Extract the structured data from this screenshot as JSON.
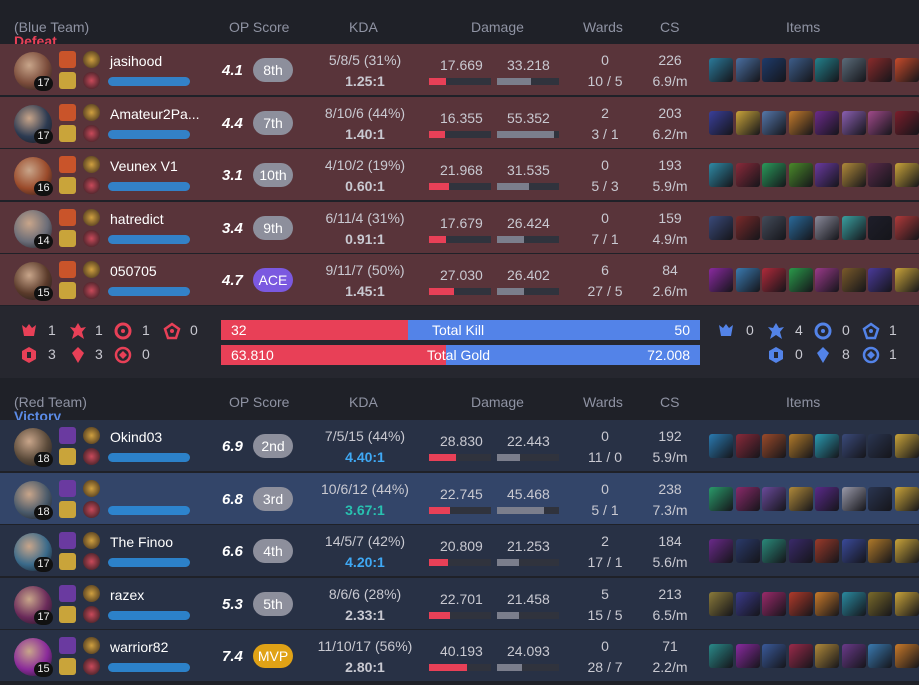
{
  "colors": {
    "defeat": "#e84057",
    "victory": "#5b8be6",
    "blue_team_bar": "#5383e8",
    "red_team_bar": "#e84057"
  },
  "columns": {
    "op_score": "OP Score",
    "kda": "KDA",
    "damage": "Damage",
    "wards": "Wards",
    "cs": "CS",
    "items": "Items"
  },
  "blue_team": {
    "result": "Defeat",
    "team_label": "(Blue Team)",
    "players": [
      {
        "name": "jasihood",
        "level": "17",
        "op": "4.1",
        "rank": "8th",
        "kda_line": "5/8/5 (31%)",
        "kda_ratio": "1.25:1",
        "dmg_dealt": "17.669",
        "dmg_taken": "33.218",
        "dmg_dealt_pct": 0.27,
        "dmg_taken_pct": 0.55,
        "wards_top": "0",
        "wards_bot": "10 / 5",
        "cs": "226",
        "cspm": "6.9/m",
        "champ_color": "#7a4b3a",
        "items": [
          "#2b7a9a",
          "#4a6fa1",
          "#1e3b6b",
          "#3d5d8a",
          "#23818c",
          "#5b6c7a",
          "#8a2b2b",
          "#c74b2b"
        ]
      },
      {
        "name": "Amateur2Pa...",
        "level": "17",
        "op": "4.4",
        "rank": "7th",
        "kda_line": "8/10/6 (44%)",
        "kda_ratio": "1.40:1",
        "dmg_dealt": "16.355",
        "dmg_taken": "55.352",
        "dmg_dealt_pct": 0.25,
        "dmg_taken_pct": 0.92,
        "wards_top": "2",
        "wards_bot": "3 / 1",
        "cs": "203",
        "cspm": "6.2/m",
        "champ_color": "#2d3b52",
        "items": [
          "#3a3f9a",
          "#c9a43a",
          "#5577aa",
          "#c27a2b",
          "#6b2b8a",
          "#8b5fb0",
          "#a04a8a",
          "#7a1e2b"
        ]
      },
      {
        "name": "Veunex V1",
        "level": "16",
        "op": "3.1",
        "rank": "10th",
        "kda_line": "4/10/2 (19%)",
        "kda_ratio": "0.60:1",
        "dmg_dealt": "21.968",
        "dmg_taken": "31.535",
        "dmg_dealt_pct": 0.33,
        "dmg_taken_pct": 0.52,
        "wards_top": "0",
        "wards_bot": "5 / 3",
        "cs": "193",
        "cspm": "5.9/m",
        "champ_color": "#9a4a2a",
        "items": [
          "#2f8aa5",
          "#8a2a3a",
          "#2a9a5a",
          "#4a8a2a",
          "#6a3aa0",
          "#b08a3a",
          "#5a2a4a",
          "#c9a43a"
        ]
      },
      {
        "name": "hatredict",
        "level": "14",
        "op": "3.4",
        "rank": "9th",
        "kda_line": "6/11/4 (31%)",
        "kda_ratio": "0.91:1",
        "dmg_dealt": "17.679",
        "dmg_taken": "26.424",
        "dmg_dealt_pct": 0.27,
        "dmg_taken_pct": 0.44,
        "wards_top": "0",
        "wards_bot": "7 / 1",
        "cs": "159",
        "cspm": "4.9/m",
        "champ_color": "#6b6d78",
        "items": [
          "#3a4a7a",
          "#7a2a2a",
          "#444c5a",
          "#2a6a9a",
          "#8a8a9a",
          "#3aa0a0",
          "#1e1e2a",
          "#b03a3a"
        ]
      },
      {
        "name": "050705",
        "level": "15",
        "op": "4.7",
        "rank": "ACE",
        "kda_line": "9/11/7 (50%)",
        "kda_ratio": "1.45:1",
        "dmg_dealt": "27.030",
        "dmg_taken": "26.402",
        "dmg_dealt_pct": 0.41,
        "dmg_taken_pct": 0.44,
        "wards_top": "6",
        "wards_bot": "27 / 5",
        "cs": "84",
        "cspm": "2.6/m",
        "champ_color": "#5a3a2a",
        "items": [
          "#8a2aa0",
          "#3a7ab0",
          "#b02a3a",
          "#2a9a4a",
          "#9a3a8a",
          "#7a5a2a",
          "#4a3a9a",
          "#c9a43a"
        ]
      }
    ],
    "objectives": {
      "baron": "1",
      "dragon": "1",
      "herald": "1",
      "void": "0",
      "tower": "3",
      "inhib": "3",
      "rift": "0"
    },
    "total_kill": "32",
    "total_gold": "63.810"
  },
  "red_team": {
    "result": "Victory",
    "team_label": "(Red Team)",
    "players": [
      {
        "name": "Okind03",
        "level": "18",
        "op": "6.9",
        "rank": "2nd",
        "kda_line": "7/5/15 (44%)",
        "kda_ratio": "4.40:1",
        "ratio_style": "blue",
        "dmg_dealt": "28.830",
        "dmg_taken": "22.443",
        "dmg_dealt_pct": 0.43,
        "dmg_taken_pct": 0.37,
        "wards_top": "0",
        "wards_bot": "11 / 0",
        "cs": "192",
        "cspm": "5.9/m",
        "champ_color": "#5a4a3a",
        "items": [
          "#2a7ab0",
          "#8a2a3a",
          "#9a4a2a",
          "#b07a2a",
          "#2a9ab0",
          "#3a4a7a",
          "#2a3550",
          "#c9a43a"
        ]
      },
      {
        "name": "",
        "level": "18",
        "op": "6.8",
        "rank": "3rd",
        "kda_line": "10/6/12 (44%)",
        "kda_ratio": "3.67:1",
        "ratio_style": "teal",
        "dmg_dealt": "22.745",
        "dmg_taken": "45.468",
        "dmg_dealt_pct": 0.34,
        "dmg_taken_pct": 0.76,
        "wards_top": "0",
        "wards_bot": "5 / 1",
        "cs": "238",
        "cspm": "7.3/m",
        "champ_color": "#4a5a6a",
        "items": [
          "#2a9a6a",
          "#8a2a6a",
          "#6a4a9a",
          "#b08a3a",
          "#5a2a8a",
          "#9a9aaa",
          "#2a3550",
          "#c9a43a"
        ]
      },
      {
        "name": "The Finoo",
        "level": "17",
        "op": "6.6",
        "rank": "4th",
        "kda_line": "14/5/7 (42%)",
        "kda_ratio": "4.20:1",
        "ratio_style": "blue",
        "dmg_dealt": "20.809",
        "dmg_taken": "21.253",
        "dmg_dealt_pct": 0.31,
        "dmg_taken_pct": 0.35,
        "wards_top": "2",
        "wards_bot": "17 / 1",
        "cs": "184",
        "cspm": "5.6/m",
        "champ_color": "#3a6a8a",
        "items": [
          "#6a2a8a",
          "#2a3a6a",
          "#2a8a7a",
          "#3a2a6a",
          "#9a3a2a",
          "#3a4a9a",
          "#b07a2a",
          "#c9a43a"
        ]
      },
      {
        "name": "razex",
        "level": "17",
        "op": "5.3",
        "rank": "5th",
        "kda_line": "8/6/6 (28%)",
        "kda_ratio": "2.33:1",
        "ratio_style": "plain",
        "dmg_dealt": "22.701",
        "dmg_taken": "21.458",
        "dmg_dealt_pct": 0.34,
        "dmg_taken_pct": 0.36,
        "wards_top": "5",
        "wards_bot": "15 / 5",
        "cs": "213",
        "cspm": "6.5/m",
        "champ_color": "#6a2a5a",
        "items": [
          "#8a7a3a",
          "#3a3a8a",
          "#9a2a6a",
          "#b03a2a",
          "#c97a2a",
          "#2a8aa0",
          "#7a6a2a",
          "#c9a43a"
        ]
      },
      {
        "name": "warrior82",
        "level": "15",
        "op": "7.4",
        "rank": "MVP",
        "kda_line": "11/10/17 (56%)",
        "kda_ratio": "2.80:1",
        "ratio_style": "plain",
        "dmg_dealt": "40.193",
        "dmg_taken": "24.093",
        "dmg_dealt_pct": 0.61,
        "dmg_taken_pct": 0.4,
        "wards_top": "0",
        "wards_bot": "28 / 7",
        "cs": "71",
        "cspm": "2.2/m",
        "champ_color": "#8a2a9a",
        "items": [
          "#2a8a8a",
          "#8a2aa0",
          "#3a5a9a",
          "#9a2a4a",
          "#b08a3a",
          "#6a3a8a",
          "#3a7ab0",
          "#c97a2a"
        ]
      }
    ],
    "objectives": {
      "baron": "0",
      "dragon": "4",
      "herald": "0",
      "void": "1",
      "tower": "0",
      "inhib": "8",
      "rift": "1"
    },
    "total_kill": "50",
    "total_gold": "72.008"
  },
  "totals": {
    "kill_label": "Total Kill",
    "gold_label": "Total Gold",
    "kill_red_fraction": 0.39,
    "gold_red_fraction": 0.47
  }
}
